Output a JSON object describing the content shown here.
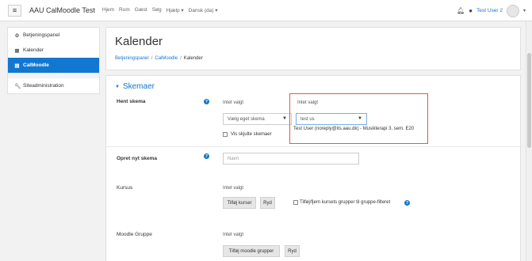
{
  "navbar": {
    "menu_icon": "hamburger-icon",
    "site_name": "AAU CalMoodle Test",
    "menu": [
      "Hjem",
      "Rum",
      "Gæst",
      "Søg",
      "Hjælp ▾",
      "Dansk (da) ▾"
    ],
    "user_name": "Test User 2",
    "bell_icon": "bell-icon",
    "chat_icon": "chat-icon"
  },
  "sidebar": {
    "items": [
      {
        "label": "Betjeningspanel",
        "icon": "dashboard-icon"
      },
      {
        "label": "Kalender",
        "icon": "calendar-icon"
      },
      {
        "label": "CalMoodle",
        "icon": "calmoodle-icon"
      },
      {
        "label": "Siteadministration",
        "icon": "wrench-icon"
      }
    ],
    "active_index": 2
  },
  "header": {
    "title": "Kalender",
    "breadcrumb": [
      "Betjeningspanel",
      "CalMoodle",
      "Kalender"
    ],
    "separator": "/"
  },
  "section": {
    "title": "Skemaer",
    "hent_skema": {
      "label": "Hent skema",
      "left_status": "Intet valgt",
      "left_select": "Vælg eget skema",
      "show_hidden": "Vis skjulte skemaer",
      "right_status": "Intet valgt",
      "right_select": "test us",
      "option": "Test User (noreply@its.aau.dk) - Musikterapi 3. sem. E20"
    },
    "opret": {
      "label": "Opret nyt skema",
      "placeholder": "Navn"
    },
    "kursus": {
      "label": "Kursus",
      "status": "Intet valgt",
      "add_button": "Tilføj kurser",
      "clear_button": "Ryd",
      "toggle_label": "Tilføj/fjern kursets grupper til gruppe-filteret"
    },
    "moodle_gruppe": {
      "label": "Moodle Gruppe",
      "status": "Intet valgt",
      "add_button": "Tilføj moodle grupper",
      "clear_button": "Ryd"
    }
  },
  "colors": {
    "accent": "#1177d1",
    "highlight": "#e25555"
  }
}
